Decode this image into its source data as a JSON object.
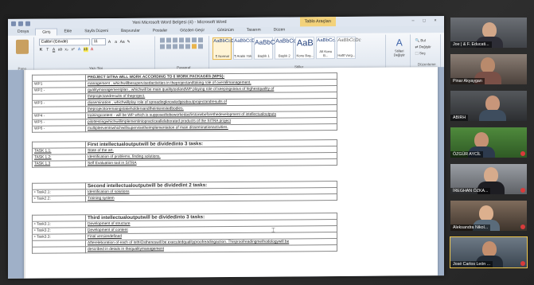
{
  "window": {
    "title": "Yeni Microsoft Word Belgesi (4) - Microsoft Word",
    "context_tab": "Tablo Araçları"
  },
  "ribbon": {
    "tabs": [
      "Dosya",
      "Giriş",
      "Ekle",
      "Sayfa Düzeni",
      "Başvurular",
      "Postalar",
      "Gözden Geçir",
      "Görünüm",
      "Tasarım",
      "Düzen"
    ],
    "font_name": "Calibri (Gövde)",
    "font_size": "11",
    "groups": [
      "Pano",
      "Yazı Tipi",
      "Paragraf",
      "Stiller",
      "Düzenleme"
    ],
    "styles": [
      {
        "preview": "AaBbCcDc",
        "label": "¶ Normal"
      },
      {
        "preview": "AaBbCcDc",
        "label": "¶ Aralık Yok"
      },
      {
        "preview": "AaBbC",
        "label": "Başlık 1"
      },
      {
        "preview": "AaBbCc",
        "label": "Başlık 2"
      },
      {
        "preview": "AaB",
        "label": "Konu Baş..."
      },
      {
        "preview": "AaBbCc.",
        "label": "Alt Konu B..."
      },
      {
        "preview": "AaBbCcDc",
        "label": "Hafif Vurg..."
      }
    ],
    "change_styles": "Stilleri Değiştir",
    "editing": [
      "Bul",
      "Değiştir",
      "Seç"
    ]
  },
  "document": {
    "wp_table": {
      "header": "PROJECT SITRA WILL WORK ACCORDING TO 6 WORK PACKAGES (WPS):",
      "rows": [
        [
          "WP1",
          "management , whichwillbesupervisedactivities in theprojectandtaking role of overallmanagement."
        ],
        [
          "WP2 -",
          "qualitymanagementplan , whichwill be main qualitytoolandWP playing role of keepingstatus of highestquality of"
        ],
        [
          "",
          "theprojectandresults of theproject."
        ],
        [
          "WP3 -",
          "dissemination , whichwillplay role of spreadingknowledgeaboutprojectandresults of"
        ],
        [
          "",
          "theprojecttoremaingstakeholdersandtheinterestedbodies."
        ],
        [
          "WP4 -",
          "trainingcontent - will be WP which is supposedtobeworkedasfirstonebeforethedevelopment of intellectualoutputs"
        ],
        [
          "WP5 -",
          "pilottestingwhichwillimplementintopracticeallelaborated products of the SITRA project"
        ],
        [
          "WP6 -",
          "multipleeventswhichwillsupervisetheimplementation of main disseminationactivities."
        ]
      ]
    },
    "io1": {
      "title": "First intellectualoutputwill be dividedinto 3 tasks:",
      "rows": [
        [
          "TASK 1.1:",
          "State of the art."
        ],
        [
          "TASK 1.2:",
          "Identification of problems, finding solutions."
        ],
        [
          "TASK 1.3",
          "Self Evaluation tool in SITRA"
        ]
      ]
    },
    "io2": {
      "title": "Second intellectualoutputwill be dividedint 2 tasks:",
      "rows": [
        [
          "• Task2.1:",
          "Identification of solutions"
        ],
        [
          "• Task2.2:",
          "Training system"
        ]
      ]
    },
    "io3": {
      "title": "Third intellectualoutputwill be dividedinto 3 tasks:",
      "rows": [
        [
          "• Task3.1:",
          "Development of structure"
        ],
        [
          "• Task3.2:",
          "Development of content"
        ],
        [
          "• Task3.3:",
          "Final versiondefined"
        ],
        [
          "",
          "Aftereleboration of each of IsthIOsthereswill be executedqualityproofreadingaction. Thisproofreadingmethodologywill be"
        ],
        [
          "",
          "described in details in thequalitymanagement"
        ]
      ]
    }
  },
  "participants": [
    {
      "name": "Joe | & F. Educati...",
      "muted": false
    },
    {
      "name": "Pinar Akyaygan",
      "muted": false
    },
    {
      "name": "ABIRH",
      "muted": false
    },
    {
      "name": "ÖZGÜR AYCİL",
      "muted": true
    },
    {
      "name": "İREGHAN ÖZKA...",
      "muted": true
    },
    {
      "name": "Aleksandra Nikol...",
      "muted": true
    },
    {
      "name": "José Carlos León ...",
      "muted": true
    }
  ],
  "colors": {
    "word_chrome": "#dfe6f0",
    "active_speaker": "#f2c94c"
  }
}
